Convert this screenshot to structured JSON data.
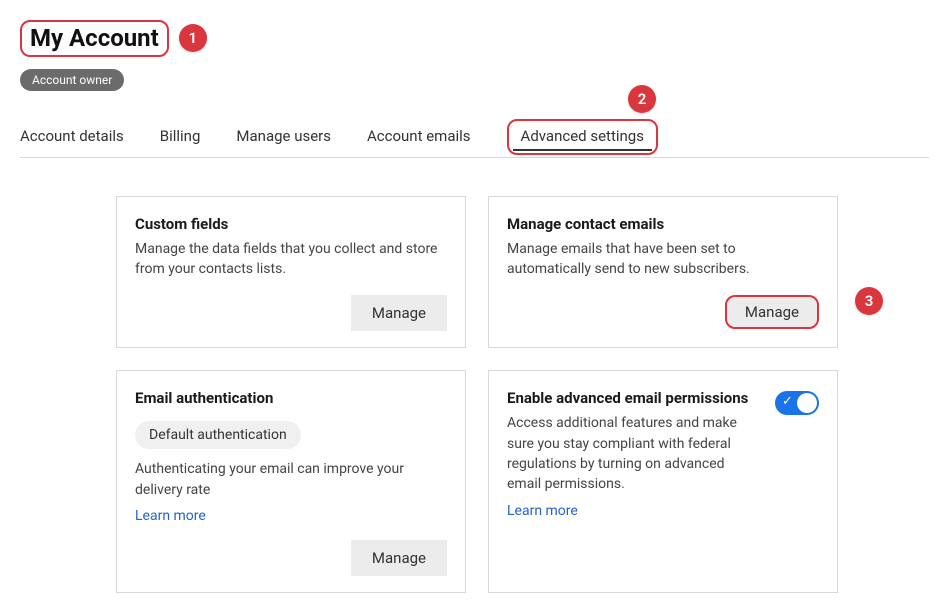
{
  "annotations": {
    "marker1": "1",
    "marker2": "2",
    "marker3": "3"
  },
  "header": {
    "title": "My Account",
    "role_badge": "Account owner"
  },
  "tabs": [
    {
      "label": "Account details",
      "active": false
    },
    {
      "label": "Billing",
      "active": false
    },
    {
      "label": "Manage users",
      "active": false
    },
    {
      "label": "Account emails",
      "active": false
    },
    {
      "label": "Advanced settings",
      "active": true
    }
  ],
  "cards": {
    "custom_fields": {
      "title": "Custom fields",
      "desc": "Manage the data fields that you collect and store from your contacts lists.",
      "button": "Manage"
    },
    "contact_emails": {
      "title": "Manage contact emails",
      "desc": "Manage emails that have been set to automatically send to new subscribers.",
      "button": "Manage"
    },
    "email_auth": {
      "title": "Email authentication",
      "chip": "Default authentication",
      "desc": "Authenticating your email can improve your delivery rate",
      "learn_more": "Learn more",
      "button": "Manage"
    },
    "advanced_perms": {
      "title": "Enable advanced email permissions",
      "desc": "Access additional features and make sure you stay compliant with federal regulations by turning on advanced email permissions.",
      "learn_more": "Learn more",
      "toggle_on": true
    }
  }
}
